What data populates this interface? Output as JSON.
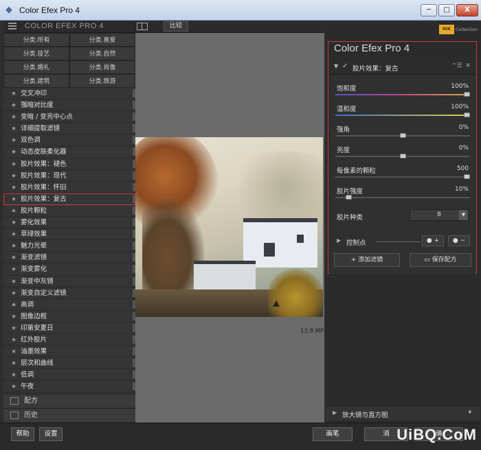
{
  "window": {
    "title": "Color Efex Pro 4",
    "min_label": "─",
    "max_label": "□",
    "close_label": "X"
  },
  "left_panel": {
    "brand": "COLOR EFEX PRO 4",
    "categories": [
      "分类.所有",
      "分类.喜爱",
      "分类.技艺",
      "分类.自然",
      "分类.婚礼",
      "分类.肖像",
      "分类.建筑",
      "分类.旅游"
    ],
    "filters": [
      "交叉冲印",
      "强暗对比度",
      "变暗 / 变亮中心点",
      "详细提取滤镜",
      "双色调",
      "动态皮肤柔化器",
      "胶片效果：褪色",
      "胶片效果：现代",
      "胶片效果：怀旧",
      "胶片效果：复古",
      "胶片颗粒",
      "雾化效果",
      "草绿效果",
      "魅力光晕",
      "渐变滤镜",
      "渐变雾化",
      "渐变中灰镜",
      "渐变自定义滤镜",
      "高调",
      "图像边框",
      "印第安夏日",
      "红外胶片",
      "油墨效果",
      "层次和曲线",
      "低调",
      "午夜"
    ],
    "selected_index": 9,
    "recipes_label": "配方",
    "history_label": "历史"
  },
  "center": {
    "compare_label": "比较",
    "megapixels": "13.8 MP"
  },
  "right_panel": {
    "badge": "NIK",
    "collection": "Collection",
    "title": "Color Efex Pro 4",
    "filter_name": "胶片效果：复古",
    "header_tools": "⁼☰ ✕",
    "sliders": [
      {
        "label": "饱和度",
        "value": "100%",
        "level": 1.0
      },
      {
        "label": "温和度",
        "value": "100%",
        "level": 1.0
      },
      {
        "label": "强角",
        "value": "0%",
        "level": 0.5
      },
      {
        "label": "亮度",
        "value": "0%",
        "level": 0.5
      },
      {
        "label": "每像素的颗粒",
        "value": "500",
        "level": 1.0
      },
      {
        "label": "胶片强度",
        "value": "10%",
        "level": 0.1
      }
    ],
    "film_type_label": "胶片种类",
    "film_type_value": "8",
    "control_points_label": "控制点",
    "cp_add_label": "+",
    "cp_remove_label": "−",
    "add_filter_label": "添加滤镜",
    "save_recipe_label": "保存配方",
    "loupe_label": "放大镜与直方图"
  },
  "bottom": {
    "help_label": "帮助",
    "settings_label": "设置",
    "cancel_label": "消",
    "brush_label": "画笔",
    "ok_label": "确",
    "watermark": "UiBQ.CoM"
  }
}
